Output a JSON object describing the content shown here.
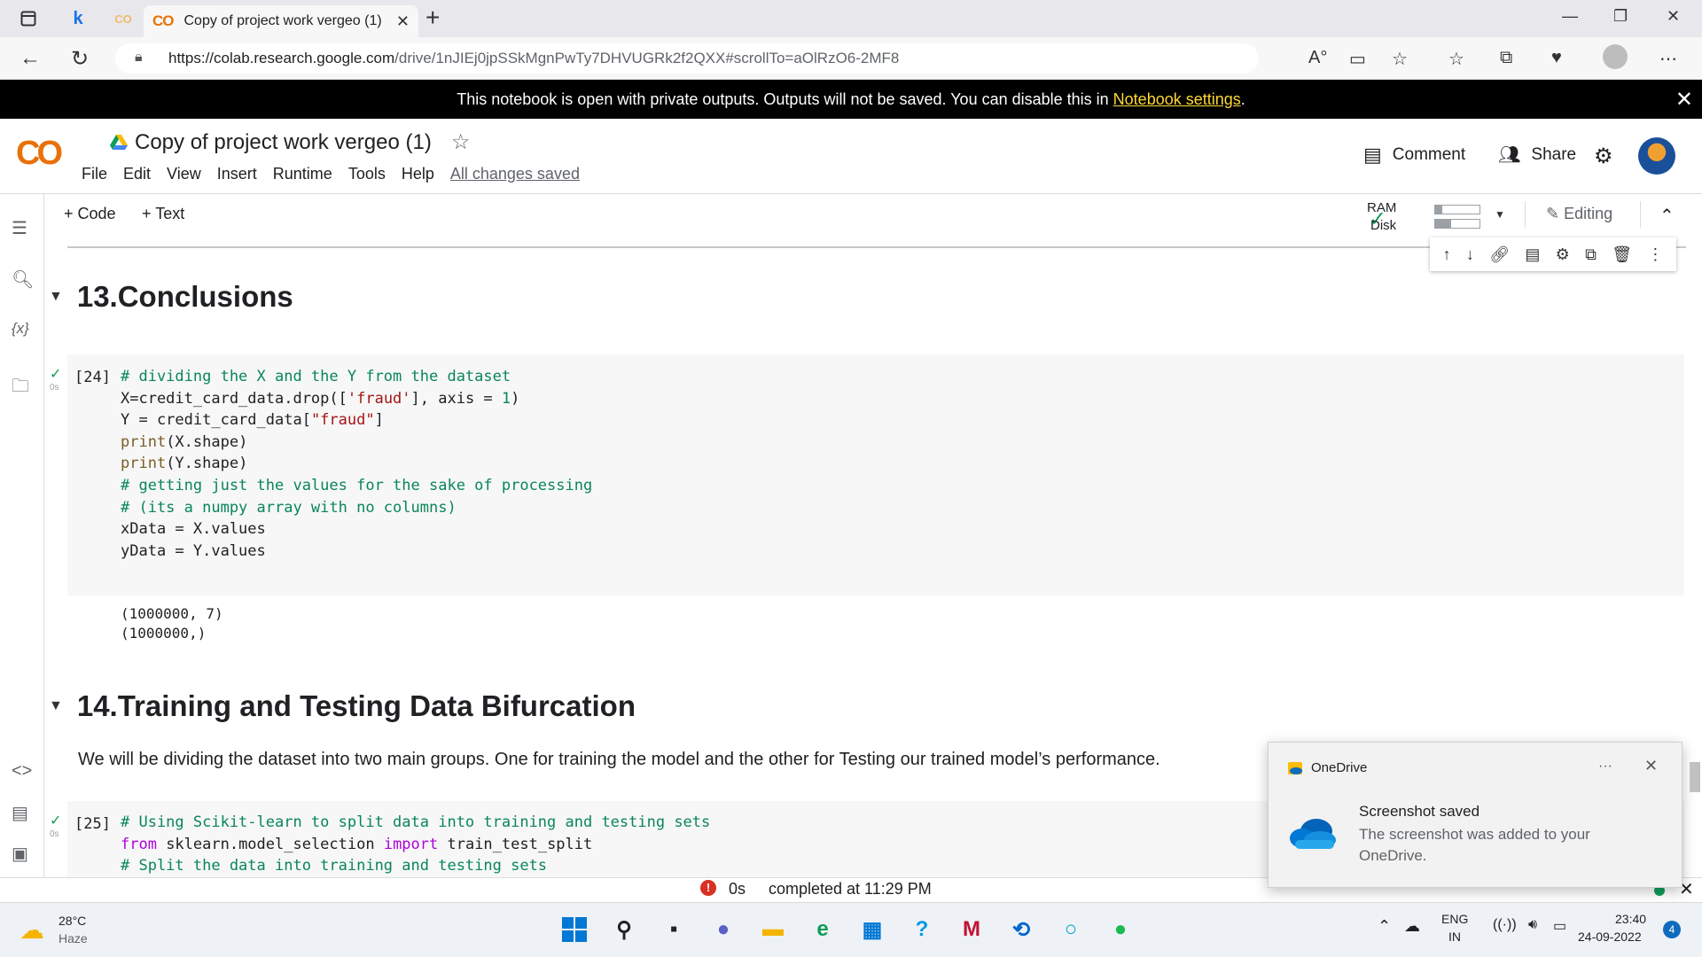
{
  "browser": {
    "tab_title": "Copy of project work vergeo (1)",
    "tab_logo": "CO",
    "pinned_tab_k": "k",
    "pinned_tab_co": "CO",
    "url_host": "https://colab.research.google.com",
    "url_path": "/drive/1nJIEj0jpSSkMgnPwTy7DHVUGRk2f2QXX#scrollTo=aOlRzO6-2MF8",
    "read_aloud": "A°"
  },
  "banner": {
    "text": "This notebook is open with private outputs. Outputs will not be saved. You can disable this in",
    "link": "Notebook settings",
    "suffix": "."
  },
  "colab": {
    "logo_left": "C",
    "logo_right": "O",
    "title": "Copy of project work vergeo (1)",
    "menu": [
      "File",
      "Edit",
      "View",
      "Insert",
      "Runtime",
      "Tools",
      "Help"
    ],
    "saved_status": "All changes saved",
    "comment_label": "Comment",
    "share_label": "Share",
    "add_code": "+ Code",
    "add_text": "+ Text",
    "ram_label": "RAM",
    "disk_label": "Disk",
    "ram_usage": 0.15,
    "disk_usage": 0.35,
    "editing_label": "Editing"
  },
  "sections": {
    "s13": "13.Conclusions",
    "s14": "14.Training and Testing Data Bifurcation"
  },
  "cell24": {
    "prompt": "[24]",
    "runtime": "0s",
    "lines": [
      "# dividing the X and the Y from the dataset",
      "X=credit_card_data.drop(['fraud'], axis = 1)",
      "Y = credit_card_data[\"fraud\"]",
      "print(X.shape)",
      "print(Y.shape)",
      "# getting just the values for the sake of processing",
      "# (its a numpy array with no columns)",
      "xData = X.values",
      "yData = Y.values"
    ],
    "output": [
      "(1000000, 7)",
      "(1000000,)"
    ]
  },
  "paragraph": "We will be dividing the dataset into two main groups. One for training the model and the other for Testing our trained model’s performance.",
  "cell25": {
    "prompt": "[25]",
    "runtime": "0s",
    "lines": [
      "# Using Scikit-learn to split data into training and testing sets",
      "from sklearn.model_selection import train_test_split",
      "# Split the data into training and testing sets"
    ]
  },
  "statusbar": {
    "duration": "0s",
    "completed": "completed at 11:29 PM"
  },
  "toast": {
    "app": "OneDrive",
    "title": "Screenshot saved",
    "body": "The screenshot was added to your OneDrive.",
    "more": "···"
  },
  "taskbar": {
    "temp": "28°C",
    "weather": "Haze",
    "lang": "ENG",
    "region": "IN",
    "time": "23:40",
    "date": "24-09-2022",
    "notif_count": "4"
  },
  "colors": {
    "colab_orange": "#e8710a",
    "colab_yellow": "#f9ab00",
    "comment_green": "#098658",
    "string_red": "#a31515",
    "keyword_purple": "#af00db",
    "run_green": "#0f9d58",
    "banner_link": "#fdd835"
  }
}
